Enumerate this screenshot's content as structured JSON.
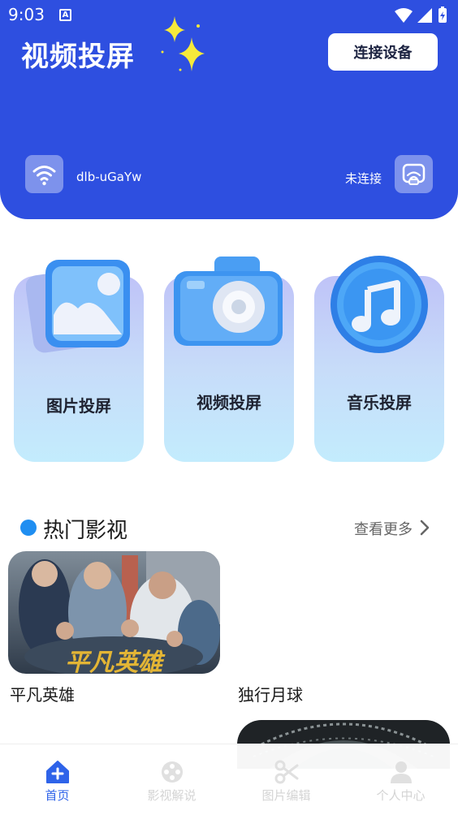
{
  "status_bar": {
    "time": "9:03",
    "notification_letter": "A"
  },
  "header": {
    "title": "视频投屏",
    "connect_button": "连接设备",
    "wifi_name": "dlb-uGaYw",
    "connection_status": "未连接"
  },
  "features": [
    {
      "label": "图片投屏",
      "icon": "image-icon"
    },
    {
      "label": "视频投屏",
      "icon": "camera-icon"
    },
    {
      "label": "音乐投屏",
      "icon": "music-icon"
    }
  ],
  "hot_section": {
    "title": "热门影视",
    "more_label": "查看更多"
  },
  "movies": [
    {
      "title": "平凡英雄",
      "poster_text": "平凡英雄"
    },
    {
      "title": "独行月球"
    }
  ],
  "bottom_nav": [
    {
      "label": "首页",
      "icon": "home-icon",
      "active": true
    },
    {
      "label": "影视解说",
      "icon": "film-reel-icon",
      "active": false
    },
    {
      "label": "图片编辑",
      "icon": "scissors-icon",
      "active": false
    },
    {
      "label": "个人中心",
      "icon": "user-icon",
      "active": false
    }
  ],
  "colors": {
    "primary": "#2e4fe0",
    "accent": "#1f8ef1",
    "nav_active": "#2e63e9"
  }
}
